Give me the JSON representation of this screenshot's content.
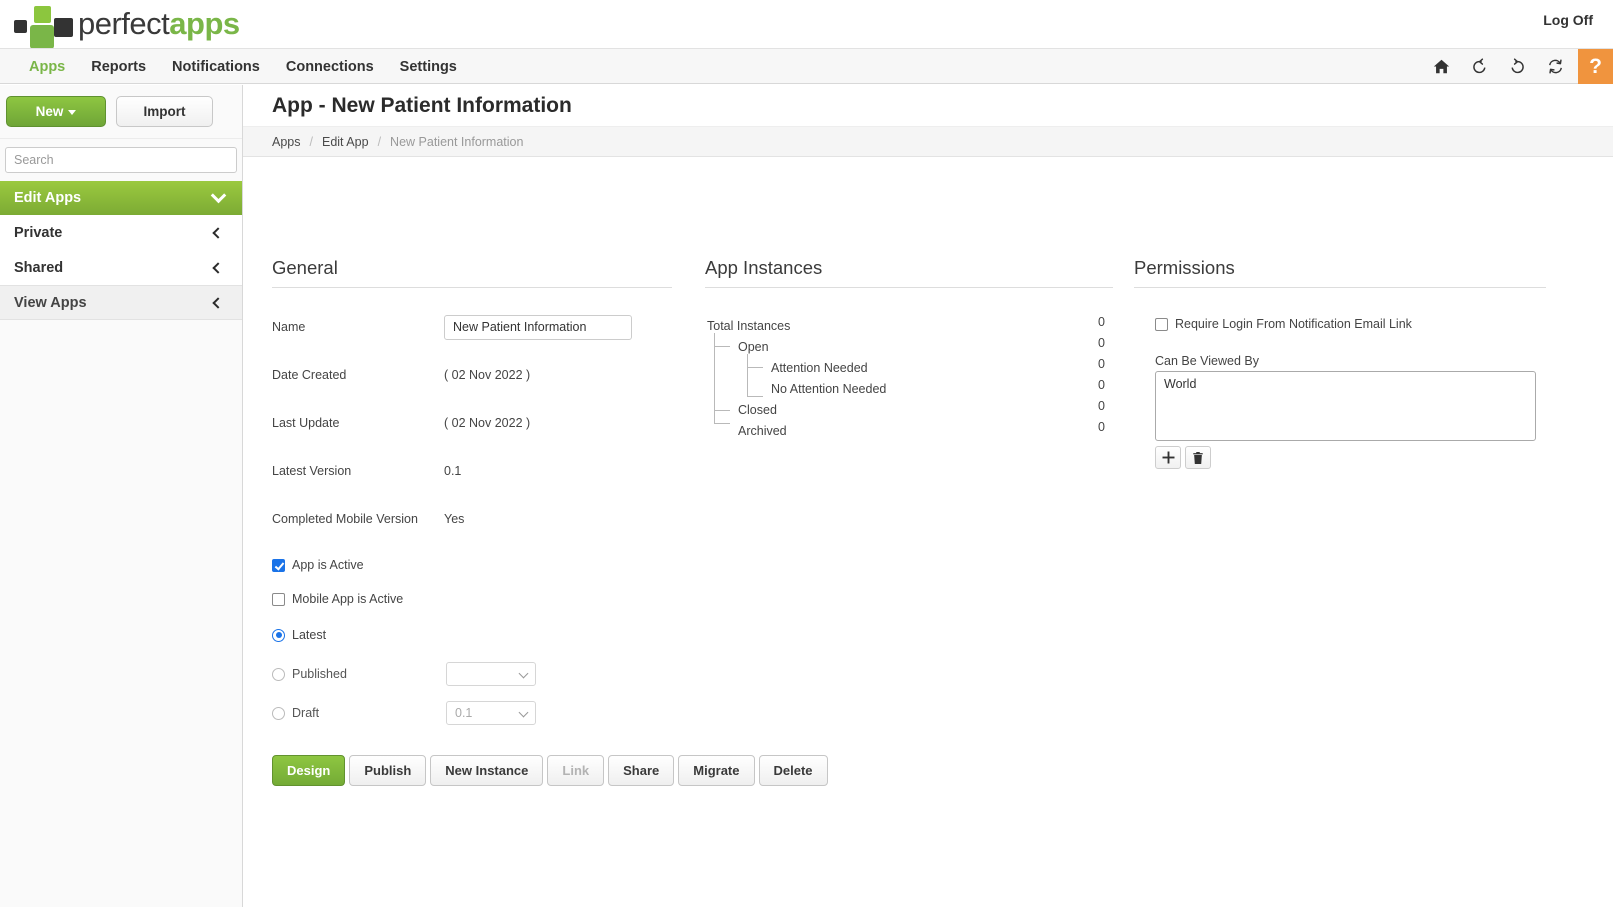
{
  "brand": {
    "name_part1": "perfect",
    "name_part2": "apps",
    "green": "#7ab648",
    "dark": "#3a3a3a"
  },
  "topbar": {
    "log_off": "Log Off"
  },
  "nav": {
    "items": [
      {
        "label": "Apps",
        "active": true
      },
      {
        "label": "Reports",
        "active": false
      },
      {
        "label": "Notifications",
        "active": false
      },
      {
        "label": "Connections",
        "active": false
      },
      {
        "label": "Settings",
        "active": false
      }
    ],
    "tools": [
      {
        "name": "home-icon"
      },
      {
        "name": "undo-icon"
      },
      {
        "name": "redo-icon"
      },
      {
        "name": "sync-icon"
      }
    ],
    "help_label": "?",
    "help_color": "#f0943e"
  },
  "sidebar": {
    "new_button": "New",
    "import_button": "Import",
    "search_placeholder": "Search",
    "search_value": "",
    "edit_apps_header": "Edit Apps",
    "edit_apps_items": [
      {
        "label": "Private"
      },
      {
        "label": "Shared"
      }
    ],
    "view_apps_header": "View Apps"
  },
  "page": {
    "title": "App - New Patient Information",
    "breadcrumb": [
      {
        "label": "Apps",
        "current": false
      },
      {
        "label": "Edit App",
        "current": false
      },
      {
        "label": "New Patient Information",
        "current": true
      }
    ],
    "crumb_separator": "/"
  },
  "general": {
    "title": "General",
    "fields": [
      {
        "label": "Name",
        "value": "New Patient Information",
        "type": "input"
      },
      {
        "label": "Date Created",
        "value": "( 02 Nov 2022 )",
        "type": "text"
      },
      {
        "label": "Last Update",
        "value": "( 02 Nov 2022 )",
        "type": "text"
      },
      {
        "label": "Latest Version",
        "value": "0.1",
        "type": "text"
      },
      {
        "label": "Completed Mobile Version",
        "value": "Yes",
        "type": "text"
      }
    ],
    "checkboxes": [
      {
        "label": "App is Active",
        "checked": true
      },
      {
        "label": "Mobile App is Active",
        "checked": false
      }
    ],
    "radios": [
      {
        "label": "Latest",
        "selected": true,
        "has_select": false
      },
      {
        "label": "Published",
        "selected": false,
        "has_select": true,
        "select_value": ""
      },
      {
        "label": "Draft",
        "selected": false,
        "has_select": true,
        "select_value": "0.1"
      }
    ],
    "buttons": [
      {
        "label": "Design",
        "style": "primary",
        "disabled": false
      },
      {
        "label": "Publish",
        "style": "default",
        "disabled": false
      },
      {
        "label": "New Instance",
        "style": "default",
        "disabled": false
      },
      {
        "label": "Link",
        "style": "default",
        "disabled": true
      },
      {
        "label": "Share",
        "style": "default",
        "disabled": false
      },
      {
        "label": "Migrate",
        "style": "default",
        "disabled": false
      },
      {
        "label": "Delete",
        "style": "default",
        "disabled": false
      }
    ]
  },
  "instances": {
    "title": "App Instances",
    "rows": [
      {
        "label": "Total Instances",
        "count": "0",
        "level": 0
      },
      {
        "label": "Open",
        "count": "0",
        "level": 1
      },
      {
        "label": "Attention Needed",
        "count": "0",
        "level": 2
      },
      {
        "label": "No Attention Needed",
        "count": "0",
        "level": 2
      },
      {
        "label": "Closed",
        "count": "0",
        "level": 1
      },
      {
        "label": "Archived",
        "count": "0",
        "level": 1
      }
    ]
  },
  "permissions": {
    "title": "Permissions",
    "require_login_label": "Require Login From Notification Email Link",
    "require_login_checked": false,
    "viewed_by_label": "Can Be Viewed By",
    "viewed_by_items": [
      "World"
    ],
    "add_icon": "plus-icon",
    "delete_icon": "trash-icon"
  }
}
